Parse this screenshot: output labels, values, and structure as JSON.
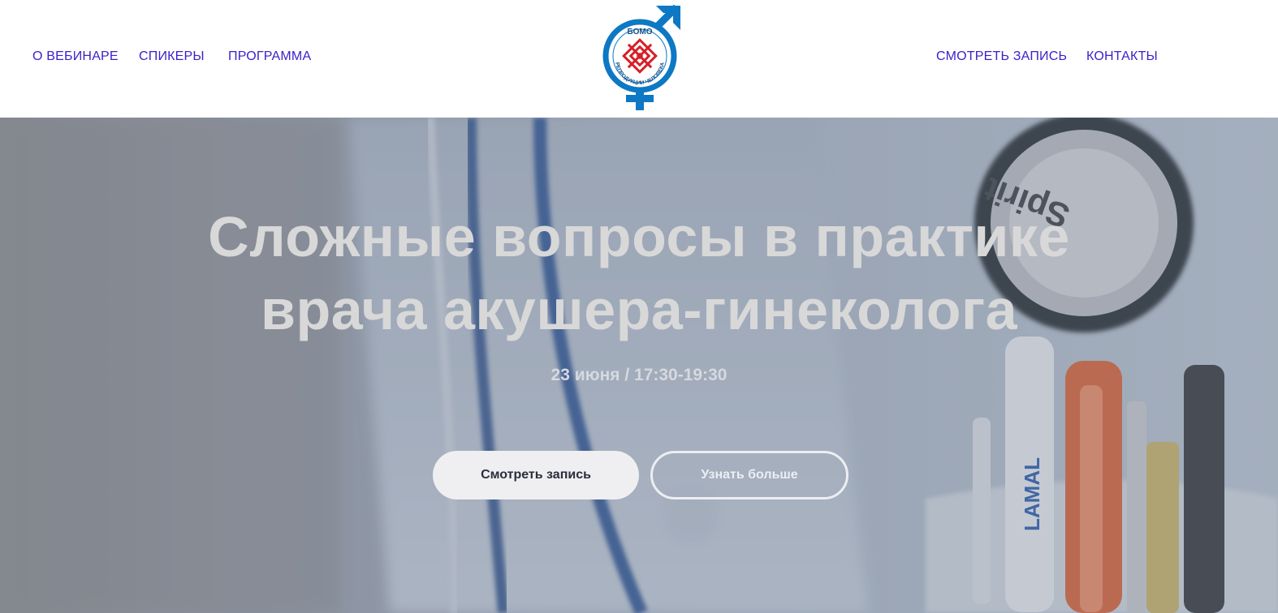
{
  "nav": {
    "left": [
      "О ВЕБИНАРЕ",
      "СПИКЕРЫ",
      "ПРОГРАММА"
    ],
    "right": [
      "СМОТРЕТЬ ЗАПИСЬ",
      "КОНТАКТЫ"
    ]
  },
  "logo": {
    "top_text": "БОМО",
    "ring_text": "РЕПРОДУКЦИИ ЧЕЛОВЕКА",
    "colors": {
      "ring": "#0d78c3",
      "ornament": "#d62027"
    }
  },
  "hero": {
    "title_line1": "Сложные вопросы в практике",
    "title_line2": "врача акушера-гинеколога",
    "date": "23 июня / 17:30-19:30",
    "primary_button": "Смотреть запись",
    "secondary_button": "Узнать больше"
  },
  "colors": {
    "nav_link": "#3a22c9",
    "hero_overlay": "#8a93a3",
    "title_text": "#d8d8d8"
  }
}
